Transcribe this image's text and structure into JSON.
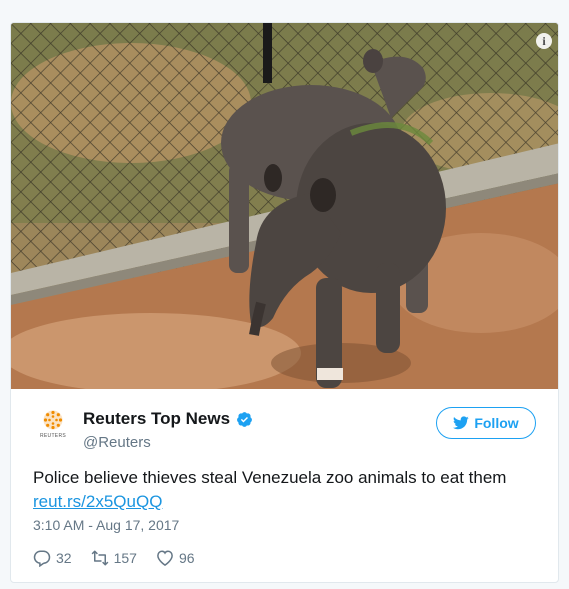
{
  "photo": {
    "subject_icon": "tapir-photo",
    "info_icon": "info-icon",
    "info_glyph": "i"
  },
  "author": {
    "logo_text": "REUTERS",
    "display_name": "Reuters Top News",
    "handle": "@Reuters",
    "verified": true
  },
  "follow": {
    "label": "Follow",
    "color": "#1da1f2"
  },
  "tweet": {
    "text": "Police believe thieves steal Venezuela zoo animals to eat them",
    "link": "reut.rs/2x5QuQQ",
    "timestamp": "3:10 AM - Aug 17, 2017",
    "link_color": "#1b95e0"
  },
  "actions": {
    "replies": "32",
    "retweets": "157",
    "likes": "96"
  }
}
